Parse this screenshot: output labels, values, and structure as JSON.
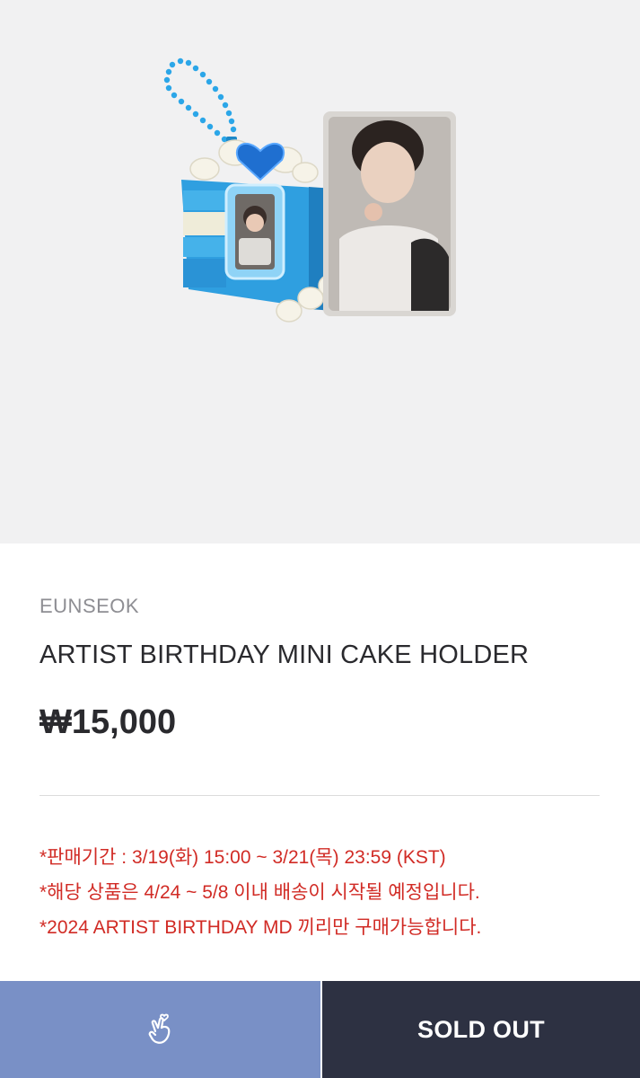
{
  "product": {
    "artist": "EUNSEOK",
    "title": "ARTIST BIRTHDAY MINI CAKE HOLDER",
    "price": "₩15,000",
    "image_alt": "mini cake holder keyring with photocard"
  },
  "notices": [
    "*판매기간 : 3/19(화) 15:00 ~ 3/21(목) 23:59 (KST)",
    "*해당 상품은 4/24 ~ 5/8 이내 배송이 시작될 예정입니다.",
    "*2024 ARTIST BIRTHDAY MD 끼리만 구매가능합니다."
  ],
  "actions": {
    "like_icon": "finger-heart-icon",
    "sold_out_label": "SOLD OUT"
  },
  "colors": {
    "hero_bg": "#f1f1f2",
    "notice_red": "#d12b25",
    "like_bg": "#7990c6",
    "sold_bg": "#2d3142",
    "cake_blue": "#2f9fe0"
  }
}
